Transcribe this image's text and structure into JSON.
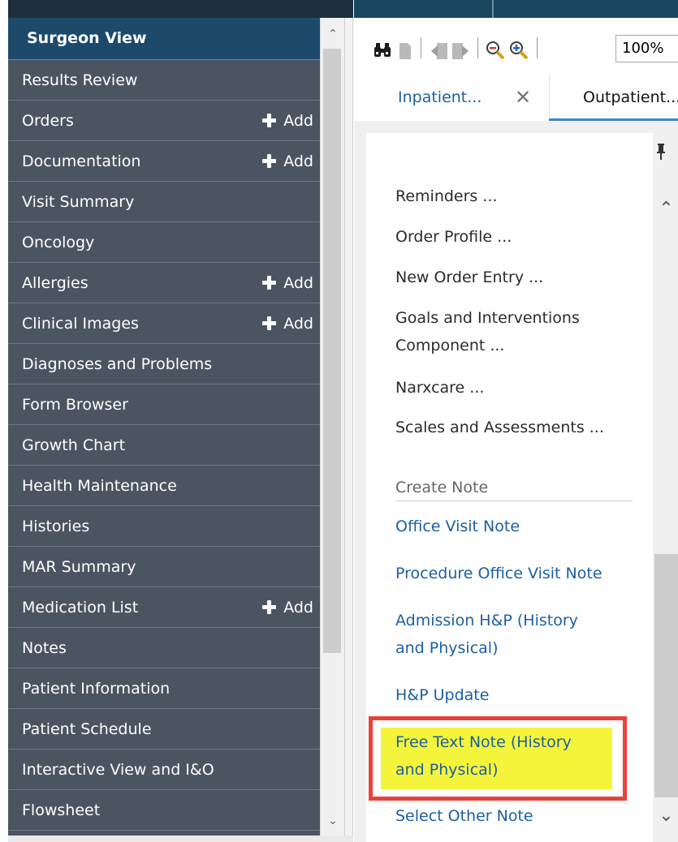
{
  "nav": {
    "header": "Surgeon View",
    "add_label": "Add",
    "items": [
      {
        "label": "Results Review",
        "add": false
      },
      {
        "label": "Orders",
        "add": true
      },
      {
        "label": "Documentation",
        "add": true
      },
      {
        "label": "Visit Summary",
        "add": false
      },
      {
        "label": "Oncology",
        "add": false
      },
      {
        "label": "Allergies",
        "add": true
      },
      {
        "label": "Clinical Images",
        "add": true
      },
      {
        "label": "Diagnoses and Problems",
        "add": false
      },
      {
        "label": "Form Browser",
        "add": false
      },
      {
        "label": "Growth Chart",
        "add": false
      },
      {
        "label": "Health Maintenance",
        "add": false
      },
      {
        "label": "Histories",
        "add": false
      },
      {
        "label": "MAR Summary",
        "add": false
      },
      {
        "label": "Medication List",
        "add": true
      },
      {
        "label": "Notes",
        "add": false
      },
      {
        "label": "Patient Information",
        "add": false
      },
      {
        "label": "Patient Schedule",
        "add": false
      },
      {
        "label": "Interactive View and I&O",
        "add": false
      },
      {
        "label": "Flowsheet",
        "add": false
      }
    ]
  },
  "toolbar": {
    "zoom": "100%",
    "icons": [
      "binoculars-icon",
      "page-icon",
      "prev-page-icon",
      "next-page-icon",
      "zoom-out-icon",
      "zoom-in-icon"
    ]
  },
  "tabs": {
    "inpatient": "Inpatient...",
    "outpatient": "Outpatient..."
  },
  "links": {
    "reminders": "Reminders ...",
    "order_profile": "Order Profile ...",
    "new_order_entry": "New Order Entry ...",
    "goals_line1": "Goals and Interventions",
    "goals_line2": "Component ...",
    "narxcare": "Narxcare ...",
    "scales": "Scales and Assessments ..."
  },
  "create_note": {
    "label": "Create Note",
    "office_visit": "Office Visit Note",
    "procedure_office": "Procedure Office Visit Note",
    "admission_line1": "Admission H&P (History",
    "admission_line2": "and Physical)",
    "hp_update": "H&P Update",
    "free_text_line1": "Free Text Note (History",
    "free_text_line2": "and Physical)",
    "select_other": "Select Other Note"
  },
  "colors": {
    "nav_bg": "#4b5561",
    "nav_header": "#1d4a6b",
    "link_blue": "#1d5fa3",
    "highlight_yellow": "#f4f53b",
    "highlight_border": "#e8423b"
  }
}
